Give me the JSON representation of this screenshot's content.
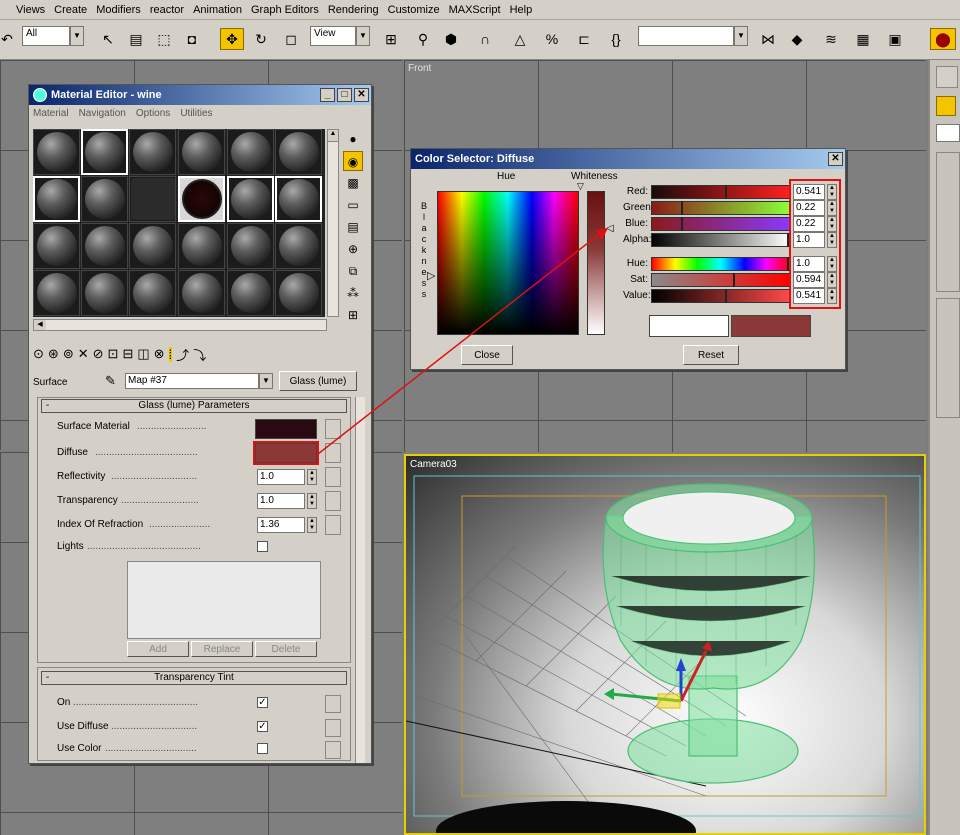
{
  "menu": [
    "Views",
    "Create",
    "Modifiers",
    "reactor",
    "Animation",
    "Graph Editors",
    "Rendering",
    "Customize",
    "MAXScript",
    "Help"
  ],
  "toolbar": {
    "selection_filter": "All",
    "ref_coord": "View",
    "selected_tool": "select-and-move"
  },
  "viewports": {
    "front_label": "Front",
    "camera_label": "Camera03"
  },
  "material_editor": {
    "title": "Material Editor - wine",
    "menu": [
      "Material",
      "Navigation",
      "Options",
      "Utilities"
    ],
    "surface_label": "Surface",
    "map_name": "Map #37",
    "material_type": "Glass (lume)",
    "rollout_params": "Glass (lume) Parameters",
    "params": [
      {
        "label": "Surface Material",
        "value": ""
      },
      {
        "label": "Diffuse",
        "value": ""
      },
      {
        "label": "Reflectivity",
        "value": "1.0"
      },
      {
        "label": "Transparency",
        "value": "1.0"
      },
      {
        "label": "Index Of Refraction",
        "value": "1.36"
      }
    ],
    "lights_label": "Lights",
    "list_buttons": [
      "Add",
      "Replace",
      "Delete"
    ],
    "rollout_tint": "Transparency Tint",
    "tint_options": [
      {
        "label": "On",
        "checked": true
      },
      {
        "label": "Use Diffuse",
        "checked": true
      },
      {
        "label": "Use Color",
        "checked": false
      }
    ],
    "colors": {
      "surface_swatch": "#2a0a12",
      "diffuse_swatch": "#8a3838"
    }
  },
  "color_selector": {
    "title": "Color Selector: Diffuse",
    "hue_label": "Hue",
    "whiteness_label": "Whiteness",
    "blackness_label": "Blackness",
    "rgb": [
      {
        "label": "Red:",
        "value": "0.541"
      },
      {
        "label": "Green:",
        "value": "0.22"
      },
      {
        "label": "Blue:",
        "value": "0.22"
      },
      {
        "label": "Alpha:",
        "value": "1.0"
      }
    ],
    "hsv": [
      {
        "label": "Hue:",
        "value": "1.0"
      },
      {
        "label": "Sat:",
        "value": "0.594"
      },
      {
        "label": "Value:",
        "value": "0.541"
      }
    ],
    "close_label": "Close",
    "reset_label": "Reset",
    "original_color": "#ffffff",
    "new_color": "#8a3838",
    "highlight_color": "#d11111"
  }
}
